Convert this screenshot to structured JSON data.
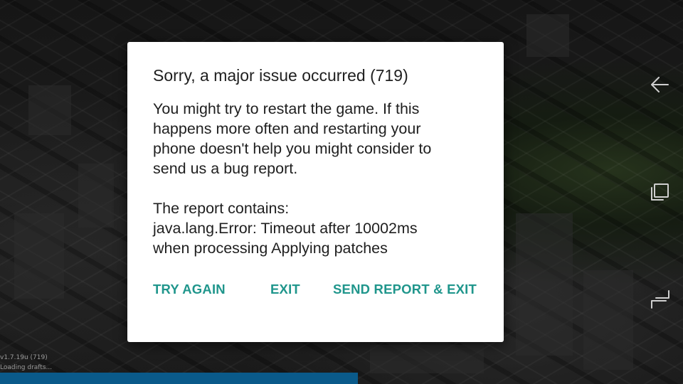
{
  "dialog": {
    "title": "Sorry, a major issue occurred (719)",
    "body_lines": [
      "You might try to restart the game. If this",
      "happens more often and restarting your",
      "phone doesn't help you might consider to",
      "send us a bug report."
    ],
    "report_lines": [
      "The report contains:",
      "java.lang.Error: Timeout after 10002ms",
      "when processing Applying patches"
    ],
    "buttons": {
      "try_again": "TRY AGAIN",
      "exit": "EXIT",
      "send_report": "SEND REPORT & EXIT"
    },
    "accent_color": "#20968c"
  },
  "status": {
    "version": "v1.7.19u (719)",
    "loading_text": "Loading drafts...",
    "progress_fraction": 0.524,
    "progress_color": "#0a5a8a"
  },
  "nav": {
    "back_icon": "back-arrow-icon",
    "recents_icon": "recents-icon",
    "home_icon": "home-icon"
  }
}
